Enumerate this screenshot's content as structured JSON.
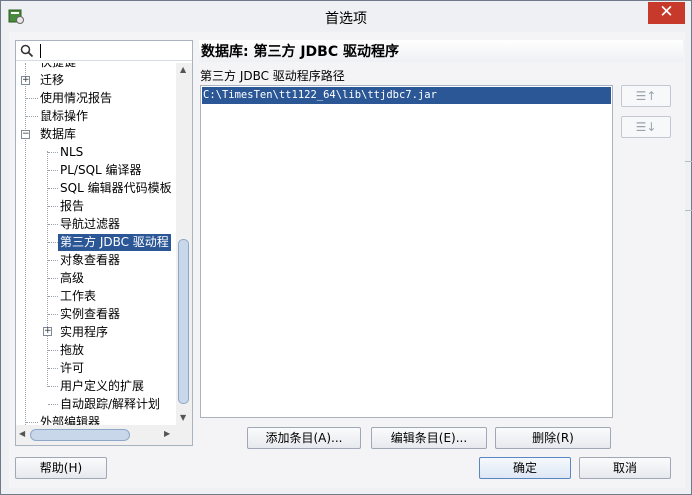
{
  "window": {
    "title": "首选项",
    "close_label": "✕"
  },
  "search": {
    "value": ""
  },
  "tree": {
    "items": [
      {
        "label": "快捷键"
      },
      {
        "label": "迁移"
      },
      {
        "label": "使用情况报告"
      },
      {
        "label": "鼠标操作"
      },
      {
        "label": "数据库"
      },
      {
        "label": "NLS"
      },
      {
        "label": "PL/SQL 编译器"
      },
      {
        "label": "SQL 编辑器代码模板"
      },
      {
        "label": "报告"
      },
      {
        "label": "导航过滤器"
      },
      {
        "label": "第三方 JDBC 驱动程"
      },
      {
        "label": "对象查看器"
      },
      {
        "label": "高级"
      },
      {
        "label": "工作表"
      },
      {
        "label": "实例查看器"
      },
      {
        "label": "实用程序"
      },
      {
        "label": "拖放"
      },
      {
        "label": "许可"
      },
      {
        "label": "用户定义的扩展"
      },
      {
        "label": "自动跟踪/解释计划"
      },
      {
        "label": "外部编辑器"
      }
    ]
  },
  "main": {
    "heading": "数据库: 第三方 JDBC 驱动程序",
    "path_label": "第三方 JDBC 驱动程序路径",
    "paths": [
      "C:\\TimesTen\\tt1122_64\\lib\\ttjdbc7.jar"
    ],
    "move_up_label": "☰↑",
    "move_down_label": "☰↓"
  },
  "actions": {
    "add": "添加条目(A)...",
    "edit": "编辑条目(E)...",
    "delete": "删除(R)"
  },
  "footer": {
    "help": "帮助(H)",
    "ok": "确定",
    "cancel": "取消"
  },
  "colors": {
    "selection": "#2b5797",
    "close_button": "#c7392b",
    "window_bg": "#eef0f3"
  }
}
